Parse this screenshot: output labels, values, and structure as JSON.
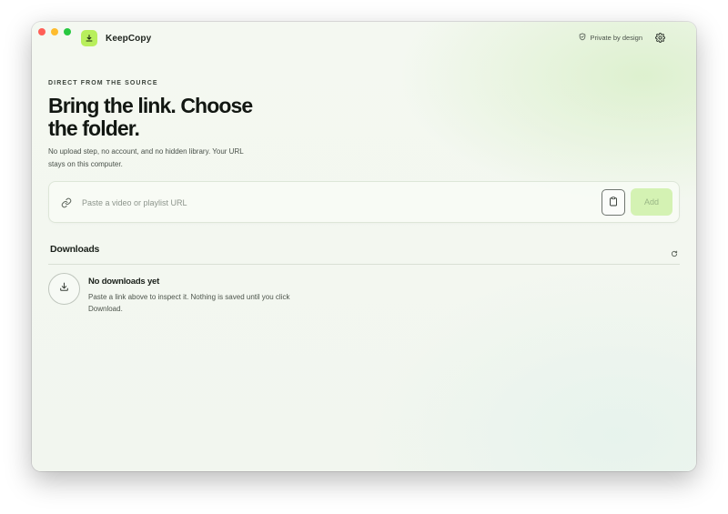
{
  "app": {
    "name": "KeepCopy",
    "brand_color": "#b8ef5c",
    "logo_icon": "download-icon"
  },
  "header": {
    "privacy_label": "Private by design",
    "privacy_icon": "shield-icon",
    "settings_icon": "gear-icon"
  },
  "hero": {
    "eyebrow": "DIRECT FROM THE SOURCE",
    "headline": "Bring the link. Choose the folder.",
    "subtext": "No upload step, no account, and no hidden library. Your URL stays on this computer."
  },
  "url_bar": {
    "value": "",
    "placeholder": "Paste a video or playlist URL",
    "link_icon": "link-icon",
    "paste_icon": "clipboard-icon",
    "add_label": "Add",
    "add_color": "#d4f2b3"
  },
  "downloads": {
    "title": "Downloads",
    "refresh_icon": "refresh-icon",
    "empty": {
      "icon": "download-icon",
      "title": "No downloads yet",
      "description": "Paste a link above to inspect it. Nothing is saved until you click Download."
    }
  }
}
